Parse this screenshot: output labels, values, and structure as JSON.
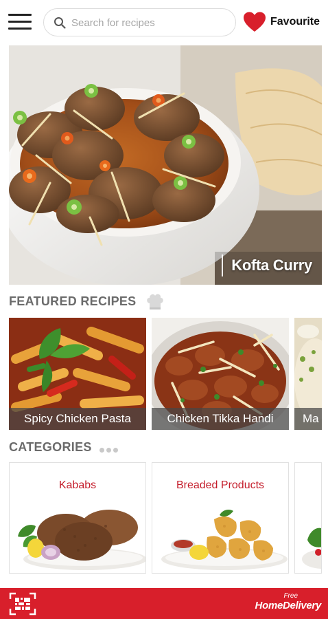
{
  "header": {
    "search_placeholder": "Search for recipes",
    "favourite_label": "Favourite"
  },
  "hero": {
    "title": "Kofta Curry"
  },
  "featured": {
    "title": "FEATURED RECIPES",
    "items": [
      {
        "label": "Spicy Chicken Pasta"
      },
      {
        "label": "Chicken Tikka Handi"
      },
      {
        "label": "Ma"
      }
    ]
  },
  "categories": {
    "title": "CATEGORIES",
    "items": [
      {
        "label": "Kababs"
      },
      {
        "label": "Breaded Products"
      },
      {
        "label": ""
      }
    ]
  },
  "footer": {
    "delivery_small": "Free",
    "delivery_big": "HomeDelivery"
  },
  "colors": {
    "brand_red": "#d81f2b",
    "category_label": "#c41d2b",
    "section_gray": "#6b6b6b"
  }
}
